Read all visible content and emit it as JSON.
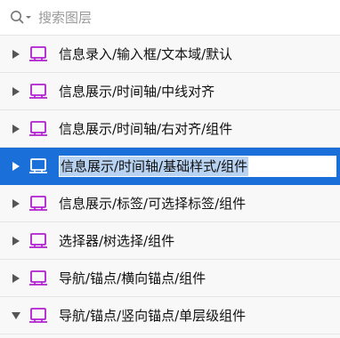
{
  "search": {
    "placeholder": "搜索图层"
  },
  "colors": {
    "icon": "#b11fcf",
    "selected_bg": "#1a6fd8",
    "arrow": "#555555"
  },
  "layers": [
    {
      "label": "信息录入/输入框/文本域/默认",
      "expanded": false,
      "selected": false
    },
    {
      "label": "信息展示/时间轴/中线对齐",
      "expanded": false,
      "selected": false
    },
    {
      "label": "信息展示/时间轴/右对齐/组件",
      "expanded": false,
      "selected": false
    },
    {
      "label": "信息展示/时间轴/基础样式/组件",
      "expanded": false,
      "selected": true
    },
    {
      "label": "信息展示/标签/可选择标签/组件",
      "expanded": false,
      "selected": false
    },
    {
      "label": "选择器/树选择/组件",
      "expanded": false,
      "selected": false
    },
    {
      "label": "导航/锚点/横向锚点/组件",
      "expanded": false,
      "selected": false
    },
    {
      "label": "导航/锚点/竖向锚点/单层级组件",
      "expanded": true,
      "selected": false
    }
  ]
}
